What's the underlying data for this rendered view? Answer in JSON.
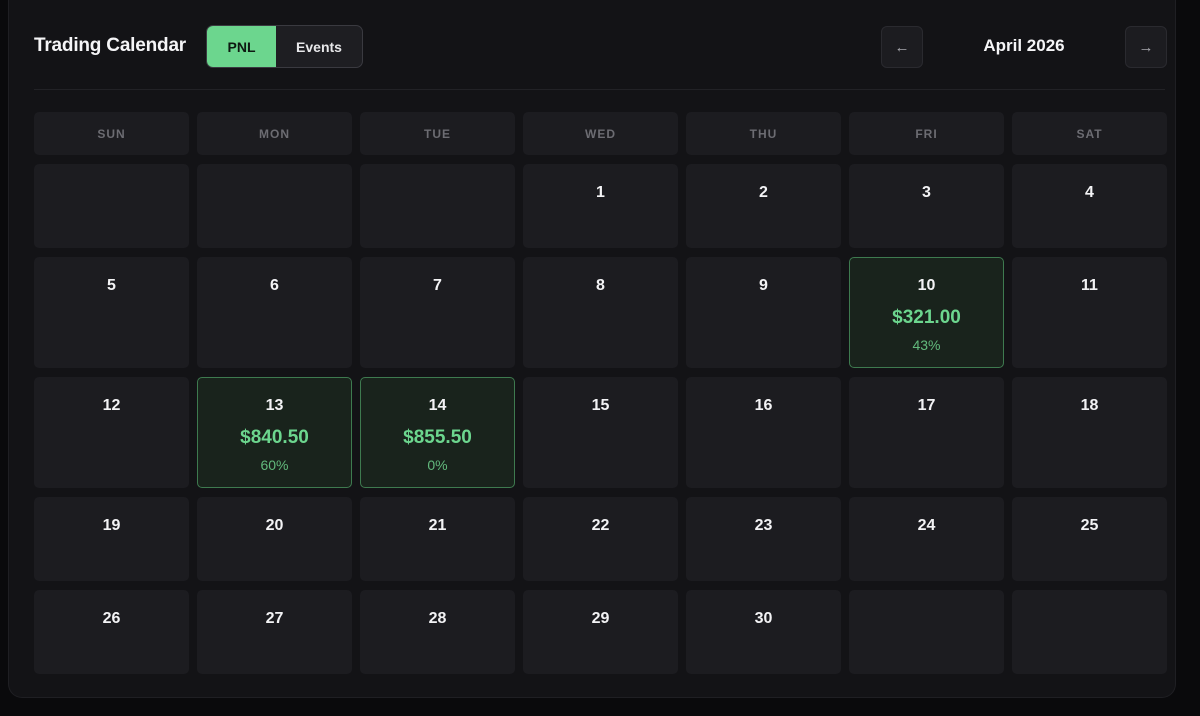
{
  "header": {
    "title": "Trading Calendar",
    "toggle": {
      "pnl_label": "PNL",
      "events_label": "Events",
      "active": "PNL"
    },
    "month_label": "April 2026",
    "prev_icon": "←",
    "next_icon": "→"
  },
  "colors": {
    "accent": "#6cd68e",
    "profit_bg": "#19231c",
    "profit_border": "#3e7a4f",
    "cell_bg": "#1c1c20",
    "panel_bg": "#131316"
  },
  "weekdays": [
    "SUN",
    "MON",
    "TUE",
    "WED",
    "THU",
    "FRI",
    "SAT"
  ],
  "weeks": [
    [
      "",
      "",
      "",
      "1",
      "2",
      "3",
      "4"
    ],
    [
      "5",
      "6",
      "7",
      "8",
      "9",
      "10",
      "11"
    ],
    [
      "12",
      "13",
      "14",
      "15",
      "16",
      "17",
      "18"
    ],
    [
      "19",
      "20",
      "21",
      "22",
      "23",
      "24",
      "25"
    ],
    [
      "26",
      "27",
      "28",
      "29",
      "30",
      "",
      ""
    ]
  ],
  "pnl_days": {
    "10": {
      "amount": "$321.00",
      "percent": "43%"
    },
    "13": {
      "amount": "$840.50",
      "percent": "60%"
    },
    "14": {
      "amount": "$855.50",
      "percent": "0%"
    }
  }
}
